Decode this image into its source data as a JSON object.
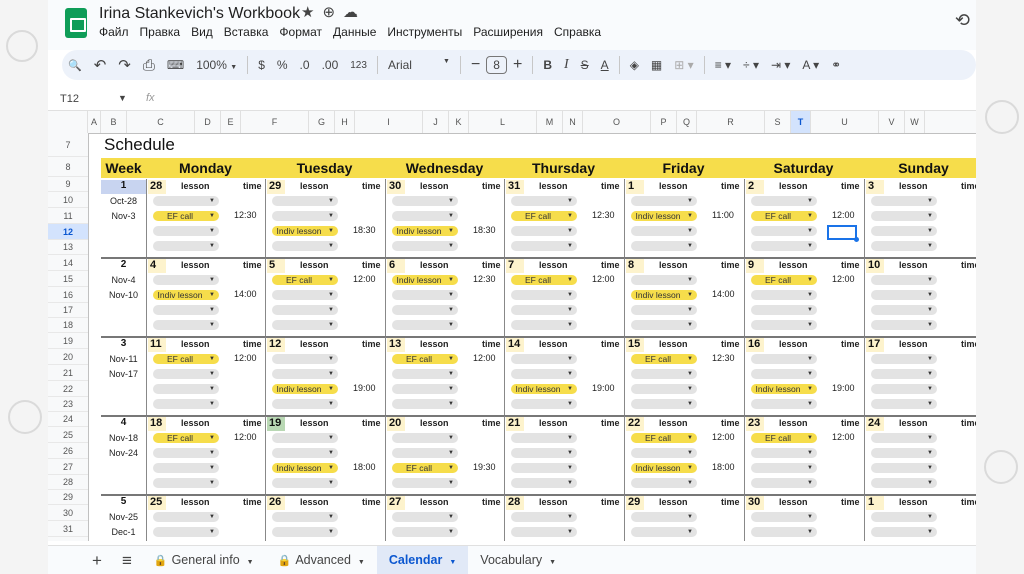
{
  "app": {
    "title": "Irina Stankevich's Workbook",
    "accent": "#0f9d58",
    "menus": [
      "Файл",
      "Правка",
      "Вид",
      "Вставка",
      "Формат",
      "Данные",
      "Инструменты",
      "Расширения",
      "Справка"
    ]
  },
  "toolbar": {
    "zoom": "100%",
    "currency": "$",
    "percent": "%",
    "dec_less": ".0",
    "dec_more": ".00",
    "number_format": "123",
    "font": "Arial",
    "font_size": "8"
  },
  "formula_bar": {
    "cell_ref": "T12",
    "formula": ""
  },
  "colors": {
    "header_yellow": "#f6dd4b",
    "date_cell": "#fdf3cd",
    "today_cell": "#b9d8b4",
    "chip_gray": "#e3e3e3",
    "selection": "#1a73e8"
  },
  "columns": [
    "A",
    "B",
    "C",
    "D",
    "E",
    "F",
    "G",
    "H",
    "I",
    "J",
    "K",
    "L",
    "M",
    "N",
    "O",
    "P",
    "Q",
    "R",
    "S",
    "T",
    "U",
    "V",
    "W"
  ],
  "rows": [
    "7",
    "8",
    "9",
    "10",
    "11",
    "12",
    "13",
    "14",
    "15",
    "16",
    "17",
    "18",
    "19",
    "20",
    "21",
    "22",
    "23",
    "24",
    "25",
    "26",
    "27",
    "28",
    "29",
    "30",
    "31"
  ],
  "selected": {
    "column": "T",
    "row": "12"
  },
  "schedule": {
    "title": "Schedule",
    "week_label": "Week",
    "days": [
      "Monday",
      "Tuesday",
      "Wednesday",
      "Thursday",
      "Friday",
      "Saturday",
      "Sunday"
    ],
    "lesson_label": "lesson",
    "time_label": "time",
    "weeks": [
      {
        "num": "1",
        "range": [
          "Oct-28",
          "Nov-3"
        ],
        "dates": [
          "28",
          "29",
          "30",
          "31",
          "1",
          "2",
          "3"
        ],
        "slots": [
          [
            {
              "t": "",
              "y": false
            },
            {
              "t": "",
              "y": false
            },
            {
              "t": "",
              "y": false
            },
            {
              "t": "",
              "y": false
            },
            {
              "t": "",
              "y": false
            },
            {
              "t": "",
              "y": false
            },
            {
              "t": "",
              "y": false
            }
          ],
          [
            {
              "t": "EF call",
              "y": true,
              "time": "12:30"
            },
            {
              "t": "",
              "y": false
            },
            {
              "t": "",
              "y": false
            },
            {
              "t": "EF call",
              "y": true,
              "time": "12:30"
            },
            {
              "t": "Indiv lesson",
              "y": true,
              "time": "11:00"
            },
            {
              "t": "EF call",
              "y": true,
              "time": "12:00"
            },
            {
              "t": "",
              "y": false
            }
          ],
          [
            {
              "t": "",
              "y": false
            },
            {
              "t": "Indiv lesson",
              "y": true,
              "time": "18:30"
            },
            {
              "t": "Indiv lesson",
              "y": true,
              "time": "18:30"
            },
            {
              "t": "",
              "y": false
            },
            {
              "t": "",
              "y": false
            },
            {
              "t": "",
              "y": false
            },
            {
              "t": "",
              "y": false
            }
          ],
          [
            {
              "t": "",
              "y": false
            },
            {
              "t": "",
              "y": false
            },
            {
              "t": "",
              "y": false
            },
            {
              "t": "",
              "y": false
            },
            {
              "t": "",
              "y": false
            },
            {
              "t": "",
              "y": false
            },
            {
              "t": "",
              "y": false
            }
          ]
        ]
      },
      {
        "num": "2",
        "range": [
          "Nov-4",
          "Nov-10"
        ],
        "dates": [
          "4",
          "5",
          "6",
          "7",
          "8",
          "9",
          "10"
        ],
        "slots": [
          [
            {
              "t": "",
              "y": false
            },
            {
              "t": "EF call",
              "y": true,
              "time": "12:00"
            },
            {
              "t": "Indiv lesson",
              "y": true,
              "time": "12:30"
            },
            {
              "t": "EF call",
              "y": true,
              "time": "12:00"
            },
            {
              "t": "",
              "y": false
            },
            {
              "t": "EF call",
              "y": true,
              "time": "12:00"
            },
            {
              "t": "",
              "y": false
            }
          ],
          [
            {
              "t": "Indiv lesson",
              "y": true,
              "time": "14:00"
            },
            {
              "t": "",
              "y": false
            },
            {
              "t": "",
              "y": false
            },
            {
              "t": "",
              "y": false
            },
            {
              "t": "Indiv lesson",
              "y": true,
              "time": "14:00"
            },
            {
              "t": "",
              "y": false
            },
            {
              "t": "",
              "y": false
            }
          ],
          [
            {
              "t": "",
              "y": false
            },
            {
              "t": "",
              "y": false
            },
            {
              "t": "",
              "y": false
            },
            {
              "t": "",
              "y": false
            },
            {
              "t": "",
              "y": false
            },
            {
              "t": "",
              "y": false
            },
            {
              "t": "",
              "y": false
            }
          ],
          [
            {
              "t": "",
              "y": false
            },
            {
              "t": "",
              "y": false
            },
            {
              "t": "",
              "y": false
            },
            {
              "t": "",
              "y": false
            },
            {
              "t": "",
              "y": false
            },
            {
              "t": "",
              "y": false
            },
            {
              "t": "",
              "y": false
            }
          ]
        ]
      },
      {
        "num": "3",
        "range": [
          "Nov-11",
          "Nov-17"
        ],
        "dates": [
          "11",
          "12",
          "13",
          "14",
          "15",
          "16",
          "17"
        ],
        "slots": [
          [
            {
              "t": "EF call",
              "y": true,
              "time": "12:00"
            },
            {
              "t": "",
              "y": false
            },
            {
              "t": "EF call",
              "y": true,
              "time": "12:00"
            },
            {
              "t": "",
              "y": false
            },
            {
              "t": "EF call",
              "y": true,
              "time": "12:30"
            },
            {
              "t": "",
              "y": false
            },
            {
              "t": "",
              "y": false
            }
          ],
          [
            {
              "t": "",
              "y": false
            },
            {
              "t": "",
              "y": false
            },
            {
              "t": "",
              "y": false
            },
            {
              "t": "",
              "y": false
            },
            {
              "t": "",
              "y": false
            },
            {
              "t": "",
              "y": false
            },
            {
              "t": "",
              "y": false
            }
          ],
          [
            {
              "t": "",
              "y": false
            },
            {
              "t": "Indiv lesson",
              "y": true,
              "time": "19:00"
            },
            {
              "t": "",
              "y": false
            },
            {
              "t": "Indiv lesson",
              "y": true,
              "time": "19:00"
            },
            {
              "t": "",
              "y": false
            },
            {
              "t": "Indiv lesson",
              "y": true,
              "time": "19:00"
            },
            {
              "t": "",
              "y": false
            }
          ],
          [
            {
              "t": "",
              "y": false
            },
            {
              "t": "",
              "y": false
            },
            {
              "t": "",
              "y": false
            },
            {
              "t": "",
              "y": false
            },
            {
              "t": "",
              "y": false
            },
            {
              "t": "",
              "y": false
            },
            {
              "t": "",
              "y": false
            }
          ]
        ]
      },
      {
        "num": "4",
        "range": [
          "Nov-18",
          "Nov-24"
        ],
        "dates": [
          "18",
          "19",
          "20",
          "21",
          "22",
          "23",
          "24"
        ],
        "slots": [
          [
            {
              "t": "EF call",
              "y": true,
              "time": "12:00"
            },
            {
              "t": "",
              "y": false
            },
            {
              "t": "",
              "y": false
            },
            {
              "t": "",
              "y": false
            },
            {
              "t": "EF call",
              "y": true,
              "time": "12:00"
            },
            {
              "t": "EF call",
              "y": true,
              "time": "12:00"
            },
            {
              "t": "",
              "y": false
            }
          ],
          [
            {
              "t": "",
              "y": false
            },
            {
              "t": "",
              "y": false
            },
            {
              "t": "",
              "y": false
            },
            {
              "t": "",
              "y": false
            },
            {
              "t": "",
              "y": false
            },
            {
              "t": "",
              "y": false
            },
            {
              "t": "",
              "y": false
            }
          ],
          [
            {
              "t": "",
              "y": false
            },
            {
              "t": "Indiv lesson",
              "y": true,
              "time": "18:00"
            },
            {
              "t": "EF call",
              "y": true,
              "time": "19:30"
            },
            {
              "t": "",
              "y": false
            },
            {
              "t": "Indiv lesson",
              "y": true,
              "time": "18:00"
            },
            {
              "t": "",
              "y": false
            },
            {
              "t": "",
              "y": false
            }
          ],
          [
            {
              "t": "",
              "y": false
            },
            {
              "t": "",
              "y": false
            },
            {
              "t": "",
              "y": false
            },
            {
              "t": "",
              "y": false
            },
            {
              "t": "",
              "y": false
            },
            {
              "t": "",
              "y": false
            },
            {
              "t": "",
              "y": false
            }
          ]
        ]
      },
      {
        "num": "5",
        "range": [
          "Nov-25",
          "Dec-1"
        ],
        "dates": [
          "25",
          "26",
          "27",
          "28",
          "29",
          "30",
          "1"
        ],
        "slots": [
          [
            {
              "t": "",
              "y": false
            },
            {
              "t": "",
              "y": false
            },
            {
              "t": "",
              "y": false
            },
            {
              "t": "",
              "y": false
            },
            {
              "t": "",
              "y": false
            },
            {
              "t": "",
              "y": false
            },
            {
              "t": "",
              "y": false
            }
          ],
          [
            {
              "t": "",
              "y": false
            },
            {
              "t": "",
              "y": false
            },
            {
              "t": "",
              "y": false
            },
            {
              "t": "",
              "y": false
            },
            {
              "t": "",
              "y": false
            },
            {
              "t": "",
              "y": false
            },
            {
              "t": "",
              "y": false
            }
          ],
          [
            {
              "t": "",
              "y": false
            },
            {
              "t": "",
              "y": false
            },
            {
              "t": "",
              "y": false
            },
            {
              "t": "",
              "y": false
            },
            {
              "t": "",
              "y": false
            },
            {
              "t": "",
              "y": false
            },
            {
              "t": "",
              "y": false
            }
          ],
          [
            {
              "t": "",
              "y": false
            },
            {
              "t": "",
              "y": false
            },
            {
              "t": "",
              "y": false
            },
            {
              "t": "",
              "y": false
            },
            {
              "t": "",
              "y": false
            },
            {
              "t": "",
              "y": false
            },
            {
              "t": "",
              "y": false
            }
          ]
        ]
      }
    ],
    "today": "19"
  },
  "sheet_tabs": [
    {
      "label": "General info",
      "locked": true,
      "active": false
    },
    {
      "label": "Advanced",
      "locked": true,
      "active": false
    },
    {
      "label": "Calendar",
      "locked": false,
      "active": true
    },
    {
      "label": "Vocabulary",
      "locked": false,
      "active": false
    }
  ],
  "icons": {
    "star": "★",
    "drive": "⊕",
    "cloud": "☁",
    "history": "⟲",
    "search": "🔍",
    "undo": "↶",
    "redo": "↷",
    "print": "⎙",
    "paint": "⌨",
    "add_sheet": "+",
    "sheets_menu": "≡",
    "lock": "🔒",
    "caret": "▼",
    "fx": "fx"
  }
}
